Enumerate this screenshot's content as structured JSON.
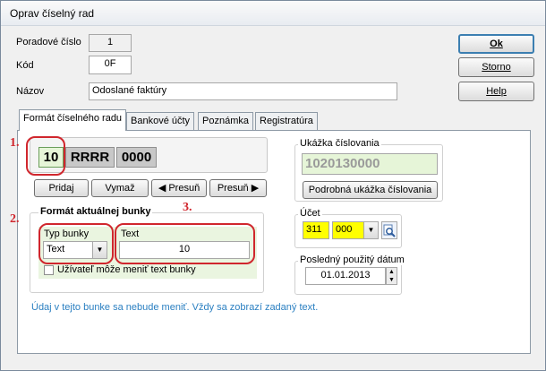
{
  "window": {
    "title": "Oprav číselný rad"
  },
  "header": {
    "poradove_label": "Poradové číslo",
    "poradove_value": "1",
    "kod_label": "Kód",
    "kod_value": "0F",
    "nazov_label": "Názov",
    "nazov_value": "Odoslané faktúry"
  },
  "buttons": {
    "ok": "Ok",
    "storno": "Storno",
    "help": "Help"
  },
  "tabs": [
    {
      "label": "Formát číselného radu"
    },
    {
      "label": "Bankové účty"
    },
    {
      "label": "Poznámka"
    },
    {
      "label": "Registratúra"
    }
  ],
  "format": {
    "cells": [
      "10",
      "RRRR",
      "0000"
    ],
    "pridaj": "Pridaj",
    "vymaz": "Vymaž",
    "presun_left": "◀ Presuň",
    "presun_right": "Presuň ▶"
  },
  "annotations": {
    "one": "1.",
    "two": "2.",
    "three": "3."
  },
  "cell_format": {
    "group_title": "Formát aktuálnej bunky",
    "typ_label": "Typ bunky",
    "typ_value": "Text",
    "text_label": "Text",
    "text_value": "10",
    "checkbox_label": "Užívateľ môže meniť text bunky",
    "checkbox_checked": false,
    "info": "Údaj v tejto bunke sa  nebude meniť. Vždy sa zobrazí zadaný text."
  },
  "preview": {
    "group_title": "Ukážka číslovania",
    "value": "1020130000",
    "button": "Podrobná ukážka číslovania"
  },
  "account": {
    "group_title": "Účet",
    "value1": "311",
    "value2": "000"
  },
  "last_date": {
    "group_title": "Posledný použitý dátum",
    "value": "01.01.2013"
  },
  "colors": {
    "red_highlight": "#d0262d",
    "preview_bg": "#e6f5d8",
    "account_yellow": "#ffff00",
    "info_text": "#2a7fc1",
    "cell_format_bg": "#eaf5e0"
  }
}
